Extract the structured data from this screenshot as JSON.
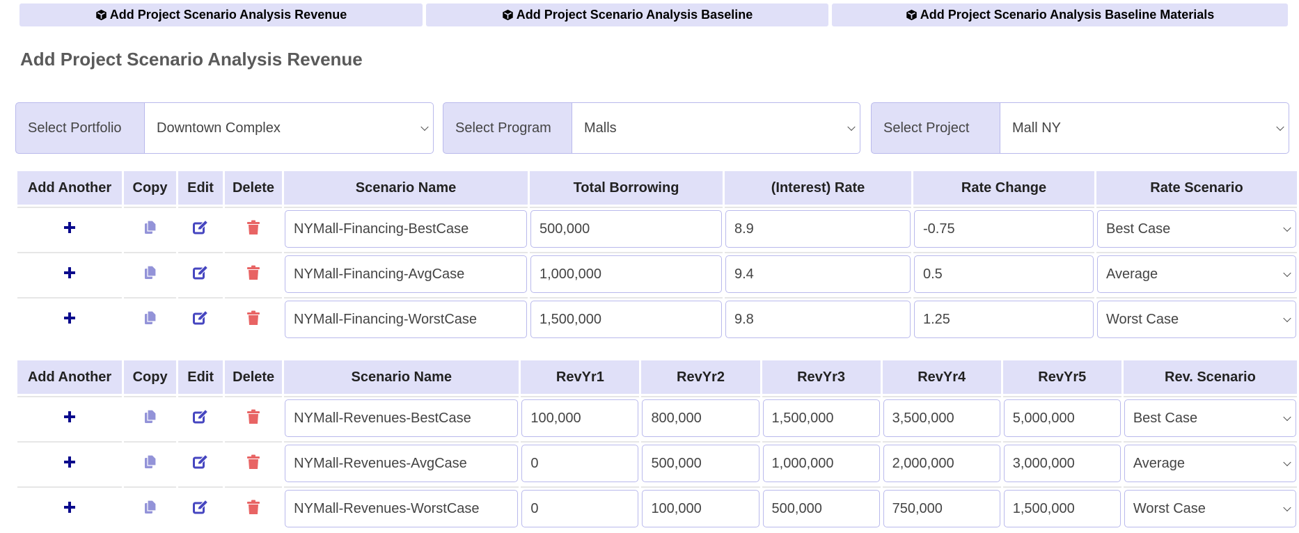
{
  "tabs": [
    {
      "label": "Add Project Scenario Analysis Revenue",
      "icon": "cube-icon"
    },
    {
      "label": "Add Project Scenario Analysis Baseline",
      "icon": "cube-icon"
    },
    {
      "label": "Add Project Scenario Analysis Baseline Materials",
      "icon": "cube-icon"
    }
  ],
  "page_title": "Add Project Scenario Analysis Revenue",
  "selectors": [
    {
      "label": "Select Portfolio",
      "value": "Downtown Complex"
    },
    {
      "label": "Select Program",
      "value": "Malls"
    },
    {
      "label": "Select Project",
      "value": "Mall NY"
    }
  ],
  "colors": {
    "accent_bg": "#e0e0f8",
    "add_icon": "#0a0a8c",
    "copy_icon": "#9393d8",
    "edit_icon": "#4646c0",
    "delete_icon": "#e86464"
  },
  "financing_table": {
    "headers": [
      "Add Another",
      "Copy",
      "Edit",
      "Delete",
      "Scenario Name",
      "Total Borrowing",
      "(Interest) Rate",
      "Rate Change",
      "Rate Scenario"
    ],
    "rows": [
      {
        "scenario_name": "NYMall-Financing-BestCase",
        "total_borrowing": "500,000",
        "interest_rate": "8.9",
        "rate_change": "-0.75",
        "rate_scenario": "Best Case"
      },
      {
        "scenario_name": "NYMall-Financing-AvgCase",
        "total_borrowing": "1,000,000",
        "interest_rate": "9.4",
        "rate_change": "0.5",
        "rate_scenario": "Average"
      },
      {
        "scenario_name": "NYMall-Financing-WorstCase",
        "total_borrowing": "1,500,000",
        "interest_rate": "9.8",
        "rate_change": "1.25",
        "rate_scenario": "Worst Case"
      }
    ]
  },
  "revenue_table": {
    "headers": [
      "Add Another",
      "Copy",
      "Edit",
      "Delete",
      "Scenario Name",
      "RevYr1",
      "RevYr2",
      "RevYr3",
      "RevYr4",
      "RevYr5",
      "Rev. Scenario"
    ],
    "rows": [
      {
        "scenario_name": "NYMall-Revenues-BestCase",
        "rev_yr1": "100,000",
        "rev_yr2": "800,000",
        "rev_yr3": "1,500,000",
        "rev_yr4": "3,500,000",
        "rev_yr5": "5,000,000",
        "rev_scenario": "Best Case"
      },
      {
        "scenario_name": "NYMall-Revenues-AvgCase",
        "rev_yr1": "0",
        "rev_yr2": "500,000",
        "rev_yr3": "1,000,000",
        "rev_yr4": "2,000,000",
        "rev_yr5": "3,000,000",
        "rev_scenario": "Average"
      },
      {
        "scenario_name": "NYMall-Revenues-WorstCase",
        "rev_yr1": "0",
        "rev_yr2": "100,000",
        "rev_yr3": "500,000",
        "rev_yr4": "750,000",
        "rev_yr5": "1,500,000",
        "rev_scenario": "Worst Case"
      }
    ]
  }
}
